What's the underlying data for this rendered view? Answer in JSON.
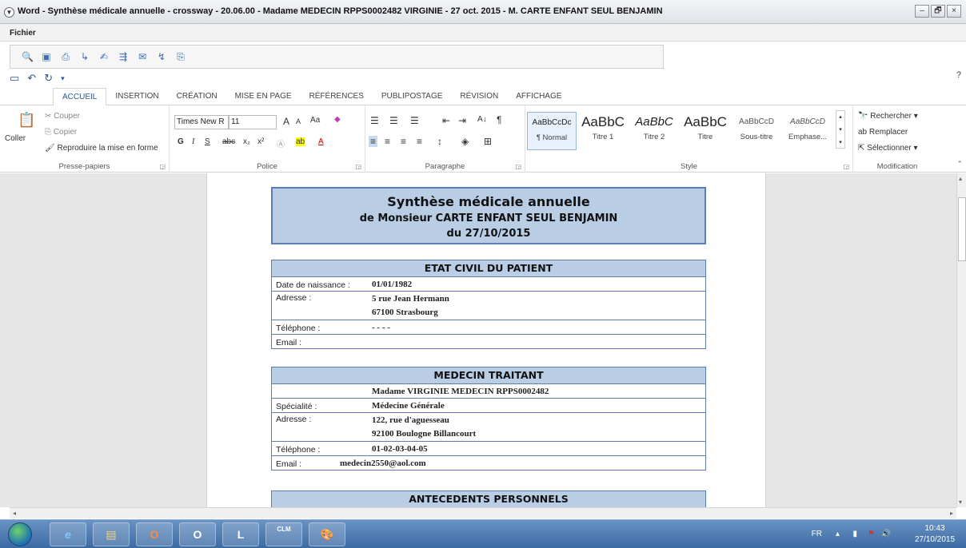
{
  "window": {
    "title": "Word - Synthèse médicale annuelle - crossway - 20.06.00 - Madame MEDECIN RPPS0002482 VIRGINIE - 27 oct. 2015 - M. CARTE ENFANT SEUL BENJAMIN",
    "menu_icon": "chevron-down-icon",
    "minimize": "–",
    "maximize": "🗗",
    "close": "×"
  },
  "filemenu": {
    "label": "Fichier"
  },
  "quick_access": {
    "help": "?"
  },
  "tabs": [
    "ACCUEIL",
    "INSERTION",
    "CRÉATION",
    "MISE EN PAGE",
    "RÉFÉRENCES",
    "PUBLIPOSTAGE",
    "RÉVISION",
    "AFFICHAGE"
  ],
  "ribbon": {
    "clipboard": {
      "paste": "Coller",
      "cut": "Couper",
      "copy": "Copier",
      "format_painter": "Reproduire la mise en forme",
      "label": "Presse-papiers"
    },
    "font": {
      "name": "Times New R",
      "size": "11",
      "grow": "A",
      "shrink": "A",
      "case": "Aa",
      "bold": "G",
      "italic": "I",
      "underline": "S",
      "strike": "abc",
      "sub": "x₂",
      "sup": "x²",
      "label": "Police"
    },
    "paragraph": {
      "label": "Paragraphe",
      "pilcrow": "¶",
      "sort": "A↓"
    },
    "styles": {
      "items": [
        {
          "preview": "AaBbCcDc",
          "name": "¶ Normal"
        },
        {
          "preview": "AaBbC",
          "name": "Titre 1"
        },
        {
          "preview": "AaBbC",
          "name": "Titre 2"
        },
        {
          "preview": "AaBbC",
          "name": "Titre"
        },
        {
          "preview": "AaBbCcD",
          "name": "Sous-titre"
        },
        {
          "preview": "AaBbCcD",
          "name": "Emphase..."
        }
      ],
      "label": "Style"
    },
    "editing": {
      "find": "Rechercher",
      "replace": "Remplacer",
      "select": "Sélectionner",
      "label": "Modification"
    }
  },
  "document": {
    "title": "Synthèse médicale annuelle",
    "subtitle": "de Monsieur CARTE ENFANT SEUL BENJAMIN",
    "date": "du 27/10/2015",
    "etat_civil": {
      "header": "ETAT CIVIL DU PATIENT",
      "rows": [
        {
          "label": "Date de naissance :",
          "value": "01/01/1982"
        },
        {
          "label": "Adresse :",
          "value": "5 rue Jean Hermann",
          "value2": "67100 Strasbourg"
        },
        {
          "label": "Téléphone :",
          "value": "- - - -"
        },
        {
          "label": "Email :",
          "value": ""
        }
      ]
    },
    "medecin": {
      "header": "MEDECIN TRAITANT",
      "name": "Madame VIRGINIE MEDECIN RPPS0002482",
      "rows": [
        {
          "label": "Spécialité :",
          "value": "Médecine Générale"
        },
        {
          "label": "Adresse :",
          "value": "122, rue d'aguesseau",
          "value2": "92100 Boulogne Billancourt"
        },
        {
          "label": "Téléphone :",
          "value": "01-02-03-04-05"
        },
        {
          "label": "Email :",
          "value": "medecin2550@aol.com"
        }
      ]
    },
    "antecedents": {
      "header": "ANTECEDENTS PERSONNELS"
    }
  },
  "taskbar": {
    "apps": [
      "e",
      "",
      "O",
      "O",
      "L",
      "CLM",
      ""
    ],
    "lang": "FR",
    "time": "10:43",
    "date": "27/10/2015"
  }
}
